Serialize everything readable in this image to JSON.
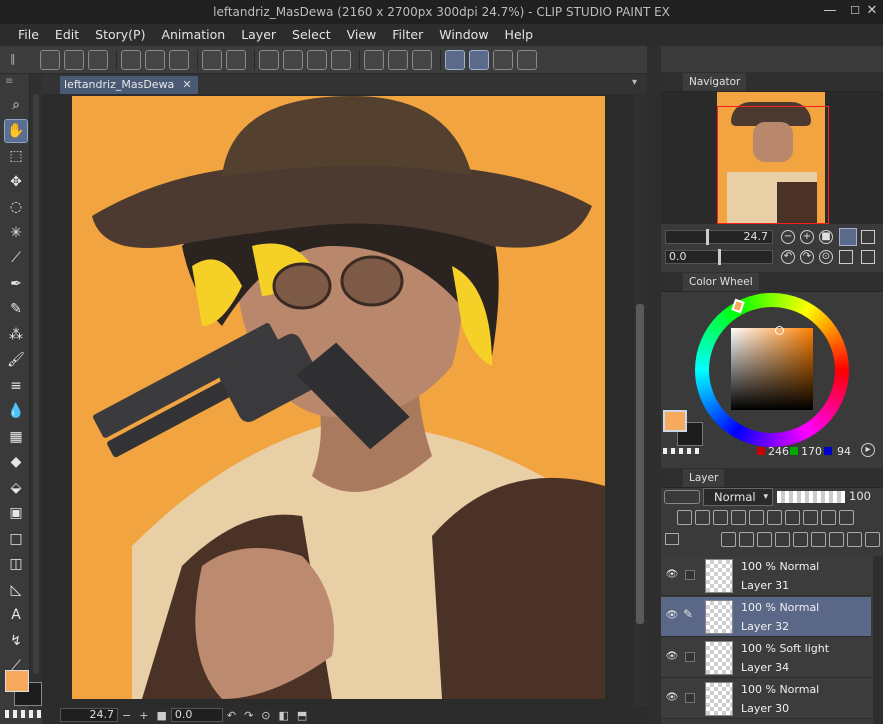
{
  "window": {
    "title": "leftandriz_MasDewa (2160 x 2700px 300dpi 24.7%)  - CLIP STUDIO PAINT EX",
    "minimize": "—",
    "maximize": "☐",
    "close": "✕"
  },
  "menu": [
    "File",
    "Edit",
    "Story(P)",
    "Animation",
    "Layer",
    "Select",
    "View",
    "Filter",
    "Window",
    "Help"
  ],
  "document_tab": {
    "label": "leftandriz_MasDewa",
    "close": "✕"
  },
  "tools": [
    {
      "name": "zoom-tool-icon",
      "glyph": "⌕"
    },
    {
      "name": "hand-tool-icon",
      "glyph": "✋",
      "active": true
    },
    {
      "name": "object-tool-icon",
      "glyph": "⬚"
    },
    {
      "name": "move-tool-icon",
      "glyph": "✥"
    },
    {
      "name": "lasso-tool-icon",
      "glyph": "◌"
    },
    {
      "name": "magic-wand-icon",
      "glyph": "✳"
    },
    {
      "name": "eyedropper-icon",
      "glyph": "⟋"
    },
    {
      "name": "pen-tool-icon",
      "glyph": "✒"
    },
    {
      "name": "pencil-tool-icon",
      "glyph": "✎"
    },
    {
      "name": "airbrush-icon",
      "glyph": "⁂"
    },
    {
      "name": "brush-tool-icon",
      "glyph": "🖌"
    },
    {
      "name": "decoration-tool-icon",
      "glyph": "≡"
    },
    {
      "name": "blend-tool-icon",
      "glyph": "💧"
    },
    {
      "name": "mesh-tool-icon",
      "glyph": "▦"
    },
    {
      "name": "eraser-tool-icon",
      "glyph": "◆"
    },
    {
      "name": "fill-tool-icon",
      "glyph": "⬙"
    },
    {
      "name": "gradient-tool-icon",
      "glyph": "▣"
    },
    {
      "name": "figure-tool-icon",
      "glyph": "□"
    },
    {
      "name": "frame-tool-icon",
      "glyph": "◫"
    },
    {
      "name": "ruler-tool-icon",
      "glyph": "◺"
    },
    {
      "name": "text-tool-icon",
      "glyph": "A"
    },
    {
      "name": "balloon-tool-icon",
      "glyph": "↯"
    },
    {
      "name": "correct-line-tool-icon",
      "glyph": "⟋"
    }
  ],
  "colors": {
    "main": "#f6aa5e",
    "sub": "#1c1c1c",
    "canvas_bg": "#f1a43f"
  },
  "status": {
    "zoom": "24.7",
    "minus": "−",
    "plus": "+",
    "angle": "0.0"
  },
  "navigator": {
    "tab_label": "Navigator",
    "zoom_value": "24.7",
    "angle_value": "0.0"
  },
  "color_wheel": {
    "tab_label": "Color Wheel",
    "r": "246",
    "g": "170",
    "b": "94",
    "hue_deg": 30
  },
  "layer_panel": {
    "tab_label": "Layer",
    "blend_mode": "Normal",
    "opacity": "100",
    "layers": [
      {
        "mode": "100 % Normal",
        "name": "Layer 31",
        "selected": false,
        "editing": false
      },
      {
        "mode": "100 % Normal",
        "name": "Layer 32",
        "selected": true,
        "editing": true
      },
      {
        "mode": "100 % Soft light",
        "name": "Layer 34",
        "selected": false,
        "editing": false
      },
      {
        "mode": "100 % Normal",
        "name": "Layer 30",
        "selected": false,
        "editing": false
      }
    ]
  }
}
